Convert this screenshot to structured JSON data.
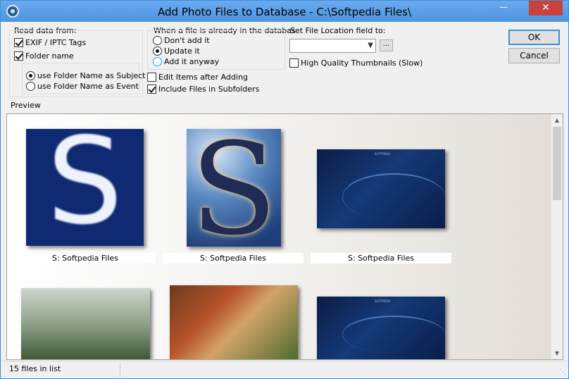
{
  "window": {
    "title": "Add Photo Files to Database - C:\\Softpedia Files\\"
  },
  "read_data": {
    "label": "Read data from:",
    "exif_label": "EXIF / IPTC Tags",
    "exif_checked": true,
    "folder_label": "Folder name",
    "folder_checked": true,
    "subject_option": "use Folder Name as Subject",
    "event_option": "use Folder Name as Event",
    "selected": "subject"
  },
  "already_in_db": {
    "label": "When a file is already in the databas",
    "options": [
      "Don't add it",
      "Update it",
      "Add it anyway"
    ],
    "selected": "Update it"
  },
  "file_location": {
    "label": "Set File Location field to:",
    "value": "",
    "browse_label": "...",
    "hq_thumbs_label": "High Quality Thumbnails (Slow)",
    "hq_thumbs_checked": false
  },
  "options": {
    "edit_items_label": "Edit Items after Adding",
    "edit_items_checked": false,
    "include_subfolders_label": "Include Files in Subfolders",
    "include_subfolders_checked": true
  },
  "buttons": {
    "ok": "OK",
    "cancel": "Cancel"
  },
  "preview": {
    "label": "Preview",
    "captions": [
      "S: Softpedia Files",
      "S: Softpedia Files",
      "S: Softpedia Files"
    ],
    "thumb_letter": "S",
    "thumb_mini_text": "SOFTPEDIA"
  },
  "status": {
    "count_text": "15 files in list"
  },
  "icons": {
    "minimize": "minimize-icon",
    "close": "close-icon",
    "dropdown": "chevron-down-icon",
    "scroll_up": "arrow-up-icon",
    "scroll_down": "arrow-down-icon",
    "resize_grip": "resize-grip-icon"
  },
  "colors": {
    "titlebar": "#5ca0e8",
    "close_button": "#c7423b",
    "accent": "#3c8fd6"
  }
}
